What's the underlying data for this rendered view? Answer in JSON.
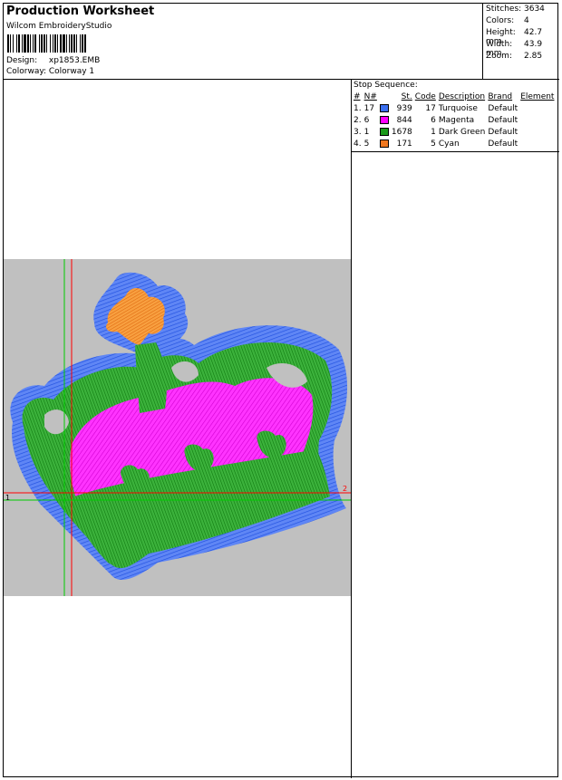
{
  "header": {
    "title": "Production Worksheet",
    "software": "Wilcom EmbroideryStudio",
    "design_label": "Design:",
    "design_value": "xp1853.EMB",
    "colorway_label": "Colorway:",
    "colorway_value": "Colorway 1"
  },
  "stats": [
    {
      "label": "Stitches:",
      "value": "3634"
    },
    {
      "label": "Colors:",
      "value": "4"
    },
    {
      "label": "Height:",
      "value": "42.7 mm"
    },
    {
      "label": "Width:",
      "value": "43.9 mm"
    },
    {
      "label": "Zoom:",
      "value": "2.85"
    }
  ],
  "stop_sequence": {
    "label": "Stop Sequence:",
    "columns": [
      "#",
      "N#",
      "St.",
      "Code",
      "Description",
      "Brand",
      "Element"
    ],
    "rows": [
      {
        "idx": "1.",
        "n": "17",
        "color": "#3a6ff0",
        "st": "939",
        "code": "17",
        "desc": "Turquoise",
        "brand": "Default",
        "element": ""
      },
      {
        "idx": "2.",
        "n": "6",
        "color": "#ff00ff",
        "st": "844",
        "code": "6",
        "desc": "Magenta",
        "brand": "Default",
        "element": ""
      },
      {
        "idx": "3.",
        "n": "1",
        "color": "#1a9a1a",
        "st": "1678",
        "code": "1",
        "desc": "Dark Green",
        "brand": "Default",
        "element": ""
      },
      {
        "idx": "4.",
        "n": "5",
        "color": "#f07820",
        "st": "171",
        "code": "5",
        "desc": "Cyan",
        "brand": "Default",
        "element": ""
      }
    ]
  },
  "canvas": {
    "marker_left": "1",
    "marker_right": "2"
  },
  "colors": {
    "canvas_bg": "#c0c0c0",
    "guide_red": "#ff0000",
    "guide_green": "#00cc00"
  }
}
